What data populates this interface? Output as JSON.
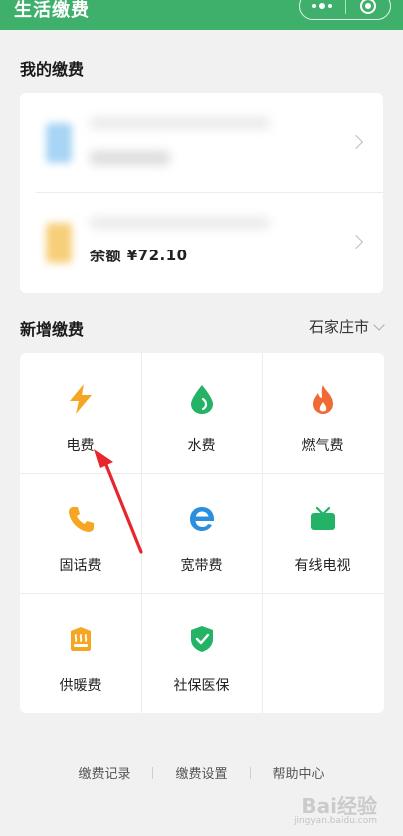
{
  "header": {
    "title": "生活缴费",
    "more_icon": "more-dots-icon",
    "close_icon": "target-circle-icon",
    "bg_color": "#3fb06c"
  },
  "my_payments": {
    "title": "我的缴费",
    "accounts": [
      {
        "icon": "blurred-blue-icon",
        "color": "#a8d4f5"
      },
      {
        "icon": "blurred-orange-icon",
        "color": "#f7cf7a",
        "balance_text": "余额 ¥72.10"
      }
    ]
  },
  "new_payment": {
    "title": "新增缴费",
    "city": "石家庄市",
    "items": [
      {
        "label": "电费",
        "icon": "lightning-icon",
        "color": "#f5a623"
      },
      {
        "label": "水费",
        "icon": "water-drop-icon",
        "color": "#24b366"
      },
      {
        "label": "燃气费",
        "icon": "flame-icon",
        "color": "#f06a35"
      },
      {
        "label": "固话费",
        "icon": "phone-icon",
        "color": "#f5a623"
      },
      {
        "label": "宽带费",
        "icon": "broadband-e-icon",
        "color": "#2b8fe0"
      },
      {
        "label": "有线电视",
        "icon": "tv-icon",
        "color": "#24b366"
      },
      {
        "label": "供暖费",
        "icon": "heating-icon",
        "color": "#f5a623"
      },
      {
        "label": "社保医保",
        "icon": "shield-check-icon",
        "color": "#24b366"
      }
    ]
  },
  "footer": {
    "links": [
      "缴费记录",
      "缴费设置",
      "帮助中心"
    ]
  },
  "watermark": {
    "text": "Bai经验",
    "sub": "jingyan.baidu.com"
  },
  "annotation": {
    "color": "#e8262e"
  }
}
